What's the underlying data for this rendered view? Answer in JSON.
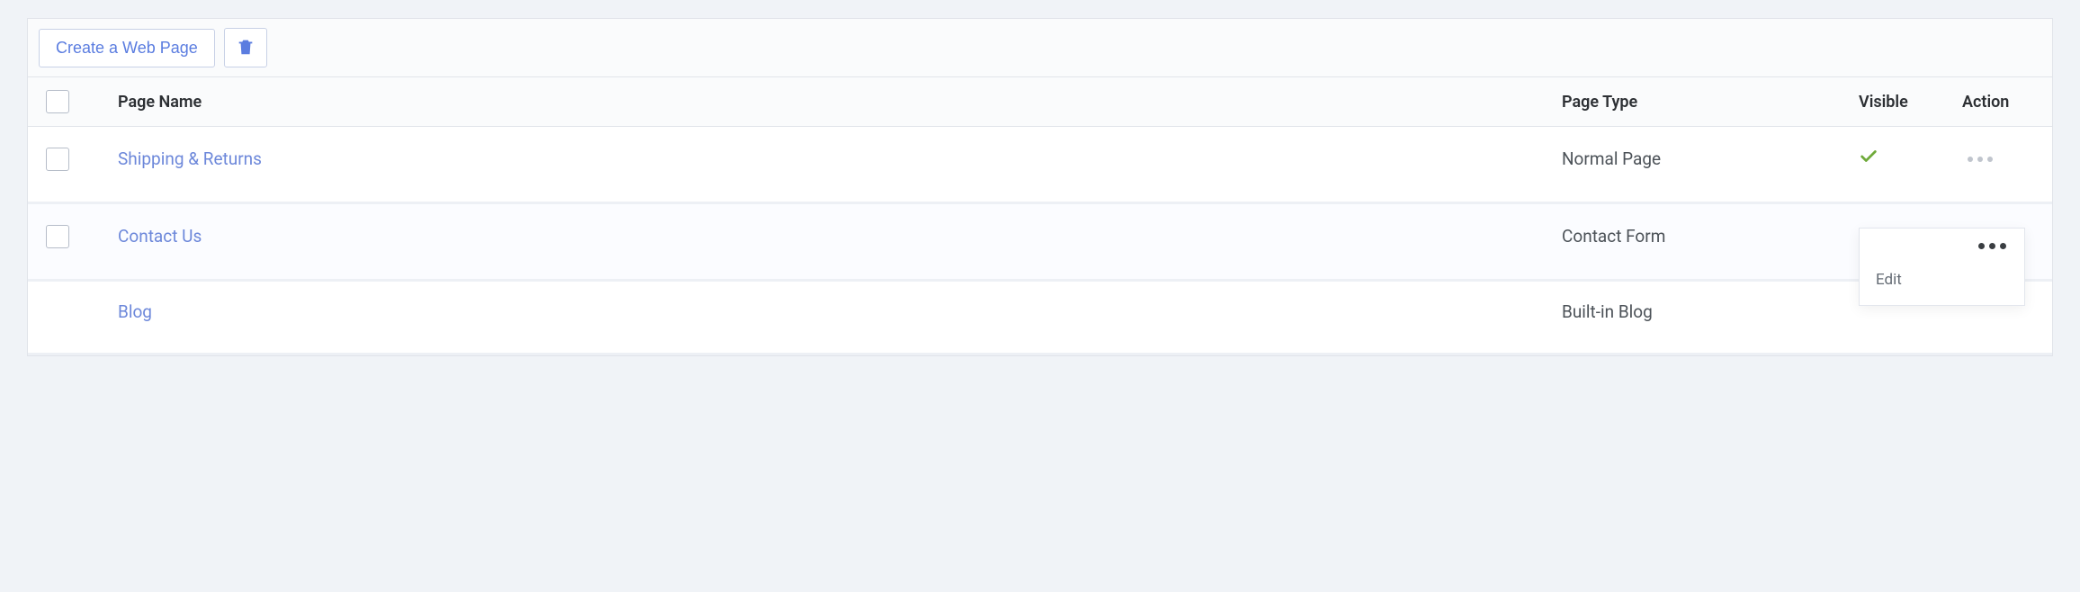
{
  "toolbar": {
    "create_label": "Create a Web Page"
  },
  "table": {
    "headers": {
      "name": "Page Name",
      "type": "Page Type",
      "visible": "Visible",
      "action": "Action"
    }
  },
  "rows": [
    {
      "name": "Shipping & Returns",
      "type": "Normal Page",
      "visible": true,
      "has_checkbox": true,
      "menu_open": false
    },
    {
      "name": "Contact Us",
      "type": "Contact Form",
      "visible": true,
      "has_checkbox": true,
      "menu_open": true
    },
    {
      "name": "Blog",
      "type": "Built-in Blog",
      "visible": false,
      "has_checkbox": false,
      "menu_open": false
    }
  ],
  "dropdown": {
    "edit_label": "Edit"
  }
}
